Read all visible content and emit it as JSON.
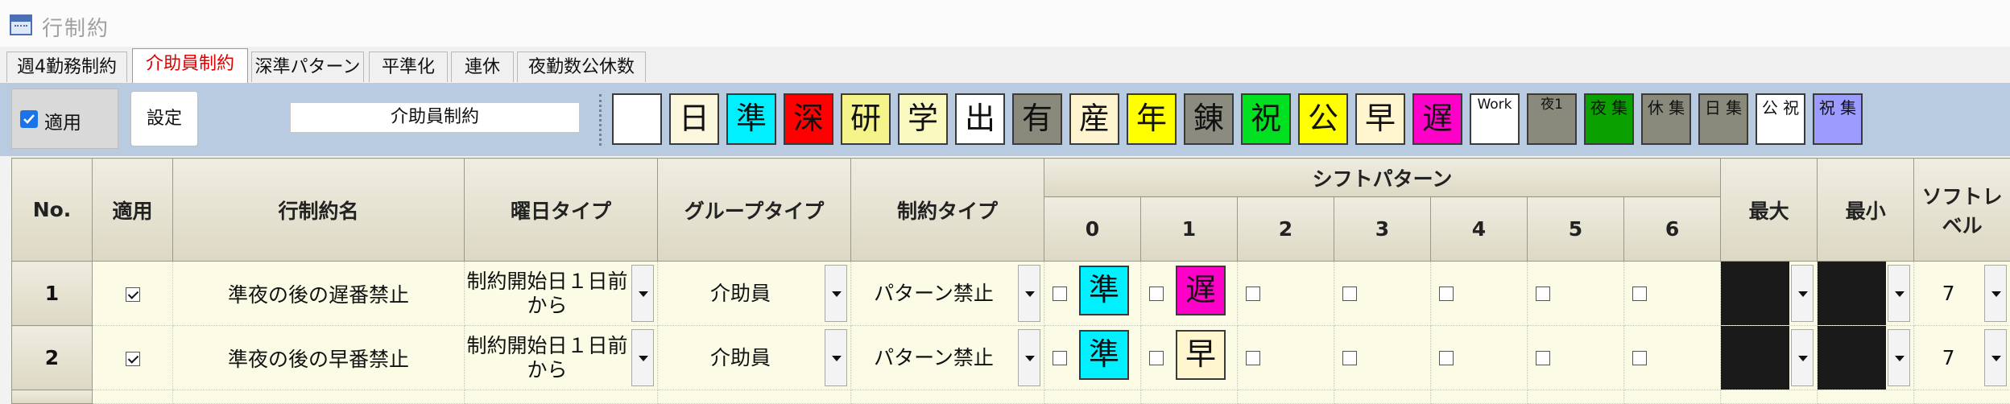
{
  "window": {
    "title": "行制約"
  },
  "tabs": [
    {
      "label": "週4勤務制約",
      "active": false
    },
    {
      "label": "介助員制約",
      "active": true
    },
    {
      "label": "深準パターン",
      "active": false
    },
    {
      "label": "平準化",
      "active": false
    },
    {
      "label": "連休",
      "active": false
    },
    {
      "label": "夜勤数公休数",
      "active": false
    }
  ],
  "toolbar": {
    "apply_label": "適用",
    "apply_checked": true,
    "settings_label": "設定",
    "constraint_name": "介助員制約"
  },
  "palette": [
    {
      "label": "",
      "bg": "#ffffff"
    },
    {
      "label": "日",
      "bg": "#fbf7dc"
    },
    {
      "label": "準",
      "bg": "#00f0ff"
    },
    {
      "label": "深",
      "bg": "#ff0000"
    },
    {
      "label": "研",
      "bg": "#f4f48a"
    },
    {
      "label": "学",
      "bg": "#fafac0"
    },
    {
      "label": "出",
      "bg": "#ffffff"
    },
    {
      "label": "有",
      "bg": "#8a8a7c"
    },
    {
      "label": "産",
      "bg": "#fff4cf"
    },
    {
      "label": "年",
      "bg": "#ffff00"
    },
    {
      "label": "錬",
      "bg": "#8b8b80"
    },
    {
      "label": "祝",
      "bg": "#00e020"
    },
    {
      "label": "公",
      "bg": "#ffff00"
    },
    {
      "label": "早",
      "bg": "#fff6d0"
    },
    {
      "label": "遅",
      "bg": "#ff00c8"
    },
    {
      "label": "Work",
      "bg": "#ffffff",
      "size": "tiny"
    },
    {
      "label": "夜1",
      "bg": "#8a8a7c",
      "size": "tiny"
    },
    {
      "label": "夜 集",
      "bg": "#0aa000",
      "size": "small"
    },
    {
      "label": "休 集",
      "bg": "#8a8a7c",
      "size": "small"
    },
    {
      "label": "日 集",
      "bg": "#8a8a7c",
      "size": "small"
    },
    {
      "label": "公 祝",
      "bg": "#ffffff",
      "size": "small"
    },
    {
      "label": "祝 集",
      "bg": "#9c9cff",
      "size": "small"
    }
  ],
  "grid": {
    "headers": {
      "no": "No.",
      "apply": "適用",
      "name": "行制約名",
      "day_type": "曜日タイプ",
      "group_type": "グループタイプ",
      "constraint_type": "制約タイプ",
      "shift_pattern": "シフトパターン",
      "shift_cols": [
        "0",
        "1",
        "2",
        "3",
        "4",
        "5",
        "6"
      ],
      "max": "最大",
      "min": "最小",
      "soft_level": "ソフトレベル"
    },
    "rows": [
      {
        "no": "1",
        "apply": true,
        "name": "準夜の後の遅番禁止",
        "day_type": "制約開始日１日前から",
        "group_type": "介助員",
        "constraint_type": "パターン禁止",
        "shifts": [
          {
            "label": "準",
            "bg": "#00f0ff"
          },
          {
            "label": "遅",
            "bg": "#ff00c8"
          },
          null,
          null,
          null,
          null,
          null
        ],
        "soft_level": "7"
      },
      {
        "no": "2",
        "apply": true,
        "name": "準夜の後の早番禁止",
        "day_type": "制約開始日１日前から",
        "group_type": "介助員",
        "constraint_type": "パターン禁止",
        "shifts": [
          {
            "label": "準",
            "bg": "#00f0ff"
          },
          {
            "label": "早",
            "bg": "#fff6d0"
          },
          null,
          null,
          null,
          null,
          null
        ],
        "soft_level": "7"
      }
    ]
  }
}
